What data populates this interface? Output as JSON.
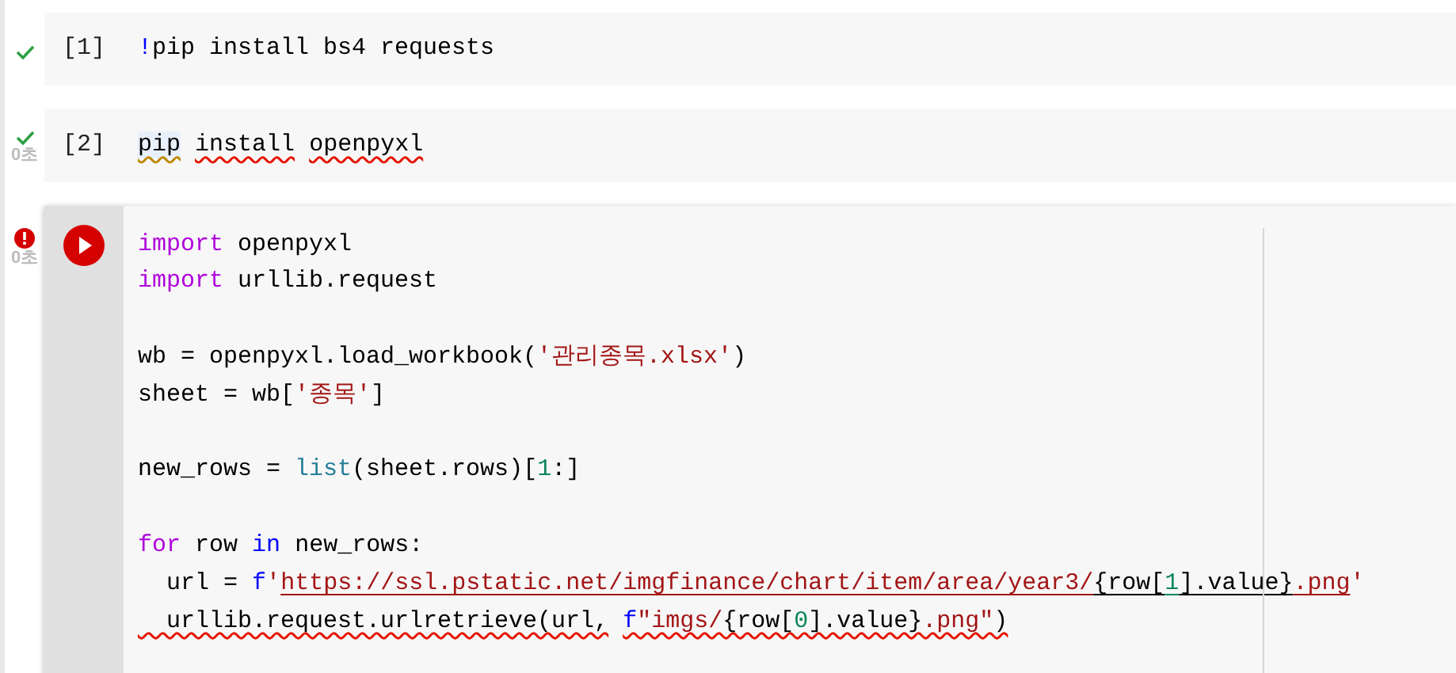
{
  "cells": [
    {
      "failed": false,
      "count": "[1]",
      "active": false,
      "lines": [
        {
          "tokens": [
            {
              "text": "!",
              "kind": "shell"
            },
            {
              "text": "pip install bs4 requests",
              "kind": "plain"
            }
          ]
        }
      ]
    },
    {
      "failed": false,
      "time": "0초",
      "count": "[2]",
      "active": false,
      "lines": [
        {
          "tokens": [
            {
              "text": "pip ",
              "kind": "plain",
              "warning_squiggle": true,
              "highlight": true
            },
            {
              "text": "install ",
              "kind": "plain",
              "error_squiggle": true
            },
            {
              "text": "openpyxl",
              "kind": "plain",
              "error_squiggle": true
            }
          ]
        }
      ]
    },
    {
      "failed": true,
      "time": "0초",
      "active": true,
      "lines": [
        {
          "tokens": [
            {
              "text": "import",
              "kind": "keyword"
            },
            {
              "text": " openpyxl",
              "kind": "plain"
            }
          ]
        },
        {
          "tokens": [
            {
              "text": "import",
              "kind": "keyword"
            },
            {
              "text": " urllib.request",
              "kind": "plain"
            }
          ]
        },
        {
          "gap_before": true,
          "tokens": [
            {
              "text": "wb = openpyxl.load_workbook(",
              "kind": "plain"
            },
            {
              "text": "'관리종목.xlsx'",
              "kind": "string"
            },
            {
              "text": ")",
              "kind": "plain"
            }
          ]
        },
        {
          "tokens": [
            {
              "text": "sheet = wb[",
              "kind": "plain"
            },
            {
              "text": "'종목'",
              "kind": "string"
            },
            {
              "text": "]",
              "kind": "plain"
            }
          ]
        },
        {
          "gap_before": true,
          "tokens": [
            {
              "text": "new_rows = ",
              "kind": "plain"
            },
            {
              "text": "list",
              "kind": "builtin"
            },
            {
              "text": "(sheet.rows)[",
              "kind": "plain"
            },
            {
              "text": "1",
              "kind": "number"
            },
            {
              "text": ":]",
              "kind": "plain"
            }
          ]
        },
        {
          "gap_before": true,
          "tokens": [
            {
              "text": "for",
              "kind": "keyword"
            },
            {
              "text": " row ",
              "kind": "plain"
            },
            {
              "text": "in",
              "kind": "fprefix"
            },
            {
              "text": " new_rows:",
              "kind": "plain"
            }
          ]
        },
        {
          "tokens": [
            {
              "text": "  url = ",
              "kind": "plain"
            },
            {
              "text": "f",
              "kind": "fprefix"
            },
            {
              "text": "'",
              "kind": "string"
            },
            {
              "text": "https://ssl.pstatic.net/imgfinance/chart/item/area/year3/",
              "kind": "string",
              "underlined": true
            },
            {
              "text": "{row[",
              "kind": "plain",
              "underlined": true
            },
            {
              "text": "1",
              "kind": "number",
              "underlined": true
            },
            {
              "text": "].value}",
              "kind": "plain",
              "underlined": true
            },
            {
              "text": ".png",
              "kind": "string",
              "underlined": true
            },
            {
              "text": "'",
              "kind": "string"
            }
          ]
        },
        {
          "tokens": [
            {
              "text": "  urllib.request.urlretrieve(url, ",
              "kind": "plain",
              "error_squiggle": true
            },
            {
              "text": "f",
              "kind": "fprefix",
              "error_squiggle": true
            },
            {
              "text": "\"imgs/",
              "kind": "string",
              "error_squiggle": true
            },
            {
              "text": "{row[",
              "kind": "plain",
              "error_squiggle": true
            },
            {
              "text": "0",
              "kind": "number",
              "error_squiggle": true
            },
            {
              "text": "].value}",
              "kind": "plain",
              "error_squiggle": true
            },
            {
              "text": ".png\"",
              "kind": "string",
              "error_squiggle": true
            },
            {
              "text": ")",
              "kind": "plain",
              "error_squiggle": true
            }
          ]
        }
      ]
    }
  ]
}
